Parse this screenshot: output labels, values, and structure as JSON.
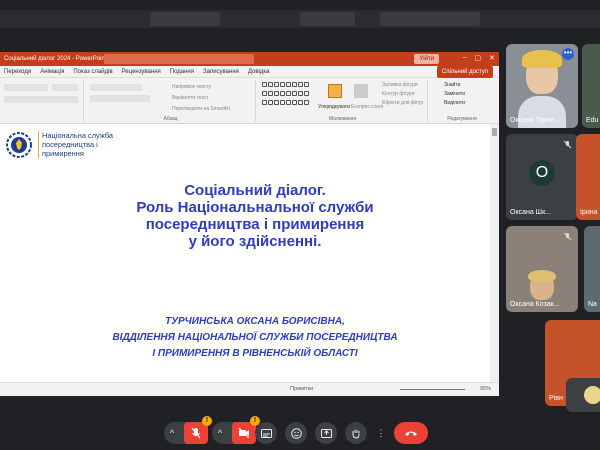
{
  "ppt": {
    "title": "Соціальний діалог 2024 - PowerPoint",
    "update_label": "Уійти",
    "share_label": "Спільний доступ",
    "menu": [
      "Переходи",
      "Анімація",
      "Показ слайдів",
      "Рецензування",
      "Подання",
      "Записування",
      "Довідка"
    ],
    "ribbon": {
      "paragraph_label": "Абзац",
      "drawing_label": "Малювання",
      "editing_label": "Редагування",
      "text_direction": "Напрямок тексту",
      "align_text": "Вирівняти текст",
      "smartart": "Перетворити на SmartArt",
      "arrange": "Упорядкувати",
      "quick_styles": "Експрес-стилі",
      "fill": "Заливка фігури",
      "outline": "Контур фігури",
      "effects": "Ефекти для фігур",
      "find": "Знайти",
      "replace": "Замінити",
      "select": "Виділити"
    },
    "status": {
      "notes": "Примітки",
      "zoom": "95%"
    }
  },
  "slide": {
    "logo_text": "Національна служба посередництва і примирення",
    "title_lines": [
      "Соціальний діалог.",
      "Роль Національнальної служби",
      "посередництва і примирення",
      "у його здійсненні."
    ],
    "author_lines": [
      "ТУРЧИНСЬКА ОКСАНА БОРИСІВНА,",
      "ВІДДІЛЕННЯ НАЦІОНАЛЬНОЇ СЛУЖБИ ПОСЕРЕДНИЦТВА",
      "І ПРИМИРЕННЯ  В РІВНЕНСЬКІЙ ОБЛАСТІ"
    ]
  },
  "participants": [
    {
      "name": "Оксана Турчи..."
    },
    {
      "name": "Edu"
    },
    {
      "name": "Оксана Шк...",
      "initial": "О"
    },
    {
      "name": "Ірина"
    },
    {
      "name": "Оксана Козак..."
    },
    {
      "name": "Na"
    },
    {
      "name": "Рівн"
    }
  ],
  "controls": {
    "mic_badge": "!",
    "cam_badge": "!",
    "more_label": "⋮"
  },
  "colors": {
    "ppt_accent": "#c43e1c",
    "slide_text": "#2f3cc0",
    "meet_bg": "#202124",
    "hangup": "#ea4335"
  }
}
